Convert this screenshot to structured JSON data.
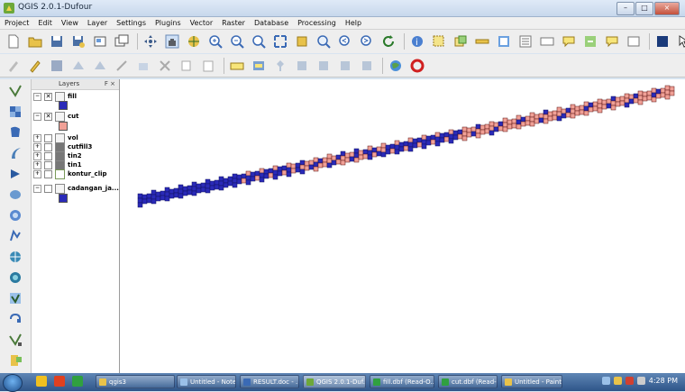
{
  "window": {
    "title": "QGIS 2.0.1-Dufour"
  },
  "menu": [
    "Project",
    "Edit",
    "View",
    "Layer",
    "Settings",
    "Plugins",
    "Vector",
    "Raster",
    "Database",
    "Processing",
    "Help"
  ],
  "layers_panel": {
    "title": "Layers",
    "header_buttons": "F ×",
    "layers": [
      {
        "name": "fill",
        "checked": true,
        "swatch": "#2a2ab8"
      },
      {
        "name": "cut",
        "checked": true,
        "swatch": "#f0a096"
      },
      {
        "name": "vol",
        "checked": false
      },
      {
        "name": "cutfill3",
        "checked": false
      },
      {
        "name": "tin2",
        "checked": false
      },
      {
        "name": "tin1",
        "checked": false
      },
      {
        "name": "kontur_clip",
        "checked": false
      },
      {
        "name": "cadangan_ja...",
        "checked": false,
        "swatch": "#2a2ab8"
      }
    ]
  },
  "colors": {
    "fill": "#2a2ab8",
    "cut": "#f0a096",
    "grid": "#5a1010"
  },
  "taskbar": {
    "items": [
      "qgis3",
      "Untitled - Note...",
      "RESULT.doc - ...",
      "QGIS 2.0.1-Duf...",
      "fill.dbf (Read-O...",
      "cut.dbf (Read-...",
      "Untitled - Paint"
    ],
    "clock": "4:28 PM"
  }
}
